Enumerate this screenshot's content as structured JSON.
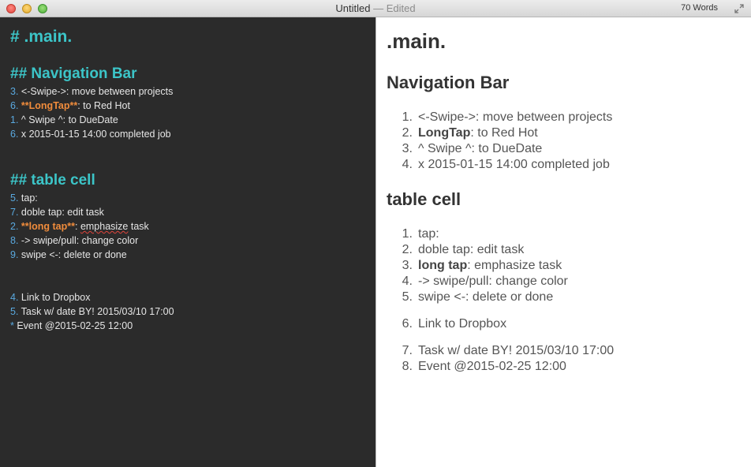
{
  "window": {
    "title": "Untitled",
    "status": "— Edited",
    "word_count": "70 Words"
  },
  "editor": {
    "h1": "# .main.",
    "h2_nav": "## Navigation Bar",
    "nav": [
      {
        "num": "3.",
        "text": " <-Swipe->: move between projects"
      },
      {
        "num": "6.",
        "strong": "**LongTap**",
        "text": ": to Red Hot"
      },
      {
        "num": "1.",
        "text": " ^ Swipe ^: to DueDate"
      },
      {
        "num": "6.",
        "text": " x 2015-01-15 14:00 completed job"
      }
    ],
    "h2_table": "## table cell",
    "table": [
      {
        "num": "5.",
        "text": " tap:"
      },
      {
        "num": "7.",
        "text": " doble tap: edit task"
      },
      {
        "num": "2.",
        "strong": "**long tap**",
        "text_a": ": ",
        "spell": "emphasize",
        "text_b": " task"
      },
      {
        "num": "8.",
        "text": " -> swipe/pull: change color"
      },
      {
        "num": "9.",
        "text": " swipe <-: delete or done"
      }
    ],
    "extra": [
      {
        "num": "4.",
        "text": " Link to Dropbox"
      },
      {
        "num": "5.",
        "text": " Task w/ date BY! 2015/03/10 17:00"
      },
      {
        "num": "*",
        "text": "  Event @2015-02-25 12:00"
      }
    ]
  },
  "preview": {
    "h1": ".main.",
    "h2_nav": "Navigation Bar",
    "nav": [
      {
        "num": "1.",
        "text": "<-Swipe->: move between projects"
      },
      {
        "num": "2.",
        "bold": "LongTap",
        "text": ": to Red Hot"
      },
      {
        "num": "3.",
        "text": "^ Swipe ^: to DueDate"
      },
      {
        "num": "4.",
        "text": "x 2015-01-15 14:00 completed job"
      }
    ],
    "h2_table": "table cell",
    "table": [
      {
        "num": "1.",
        "text": "tap:"
      },
      {
        "num": "2.",
        "text": "doble tap: edit task"
      },
      {
        "num": "3.",
        "bold": "long tap",
        "text": ": emphasize task"
      },
      {
        "num": "4.",
        "text": "-> swipe/pull: change color"
      },
      {
        "num": "5.",
        "text": "swipe <-: delete or done"
      },
      {
        "num": "6.",
        "text": "Link to Dropbox"
      },
      {
        "num": "7.",
        "text": "Task w/ date BY! 2015/03/10 17:00"
      },
      {
        "num": "8.",
        "text": "Event @2015-02-25 12:00"
      }
    ]
  },
  "colors": {
    "editor_bg": "#2b2b2b",
    "heading": "#3cc5c8",
    "list_number": "#5aa9df",
    "strong": "#f08c3c"
  }
}
